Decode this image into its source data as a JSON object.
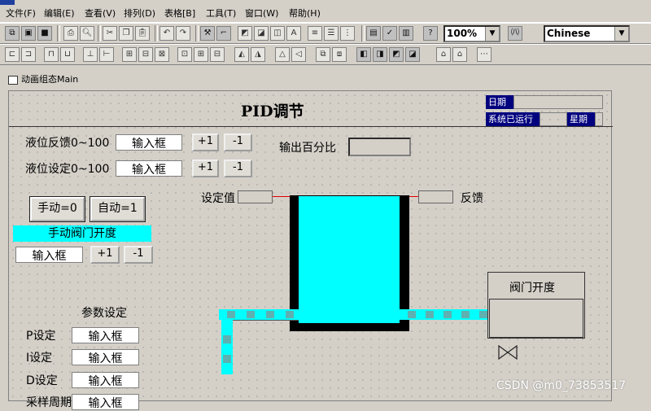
{
  "menu": [
    "文件(F)",
    "编辑(E)",
    "查看(V)",
    "排列(D)",
    "表格[B]",
    "工具(T)",
    "窗口(W)",
    "帮助(H)"
  ],
  "toolbar": {
    "zoom": "100%",
    "language": "Chinese"
  },
  "window": {
    "title": "动画组态Main"
  },
  "header": {
    "title": "PID调节",
    "date_label": "日期",
    "uptime_label": "系统已运行",
    "weekday_label": "星期"
  },
  "level_feedback": {
    "label": "液位反馈0~100",
    "input": "输入框",
    "plus": "+1",
    "minus": "-1"
  },
  "level_setpoint": {
    "label": "液位设定0~100",
    "input": "输入框",
    "plus": "+1",
    "minus": "-1"
  },
  "output_percent_label": "输出百分比",
  "mode": {
    "manual": "手动=0",
    "auto": "自动=1"
  },
  "manual_valve": {
    "label": "手动阀门开度",
    "input": "输入框",
    "plus": "+1",
    "minus": "-1"
  },
  "tank": {
    "setpoint_label": "设定值",
    "feedback_label": "反馈"
  },
  "valve_panel": {
    "label": "阀门开度"
  },
  "params": {
    "title": "参数设定",
    "rows": [
      {
        "label": "P设定",
        "input": "输入框"
      },
      {
        "label": "I设定",
        "input": "输入框"
      },
      {
        "label": "D设定",
        "input": "输入框"
      },
      {
        "label": "采样周期",
        "input": "输入框"
      }
    ]
  },
  "watermark": "CSDN @m0_73853517",
  "colors": {
    "tank_fill": "#00ffff",
    "canvas_bg": "#d4d0c8"
  }
}
